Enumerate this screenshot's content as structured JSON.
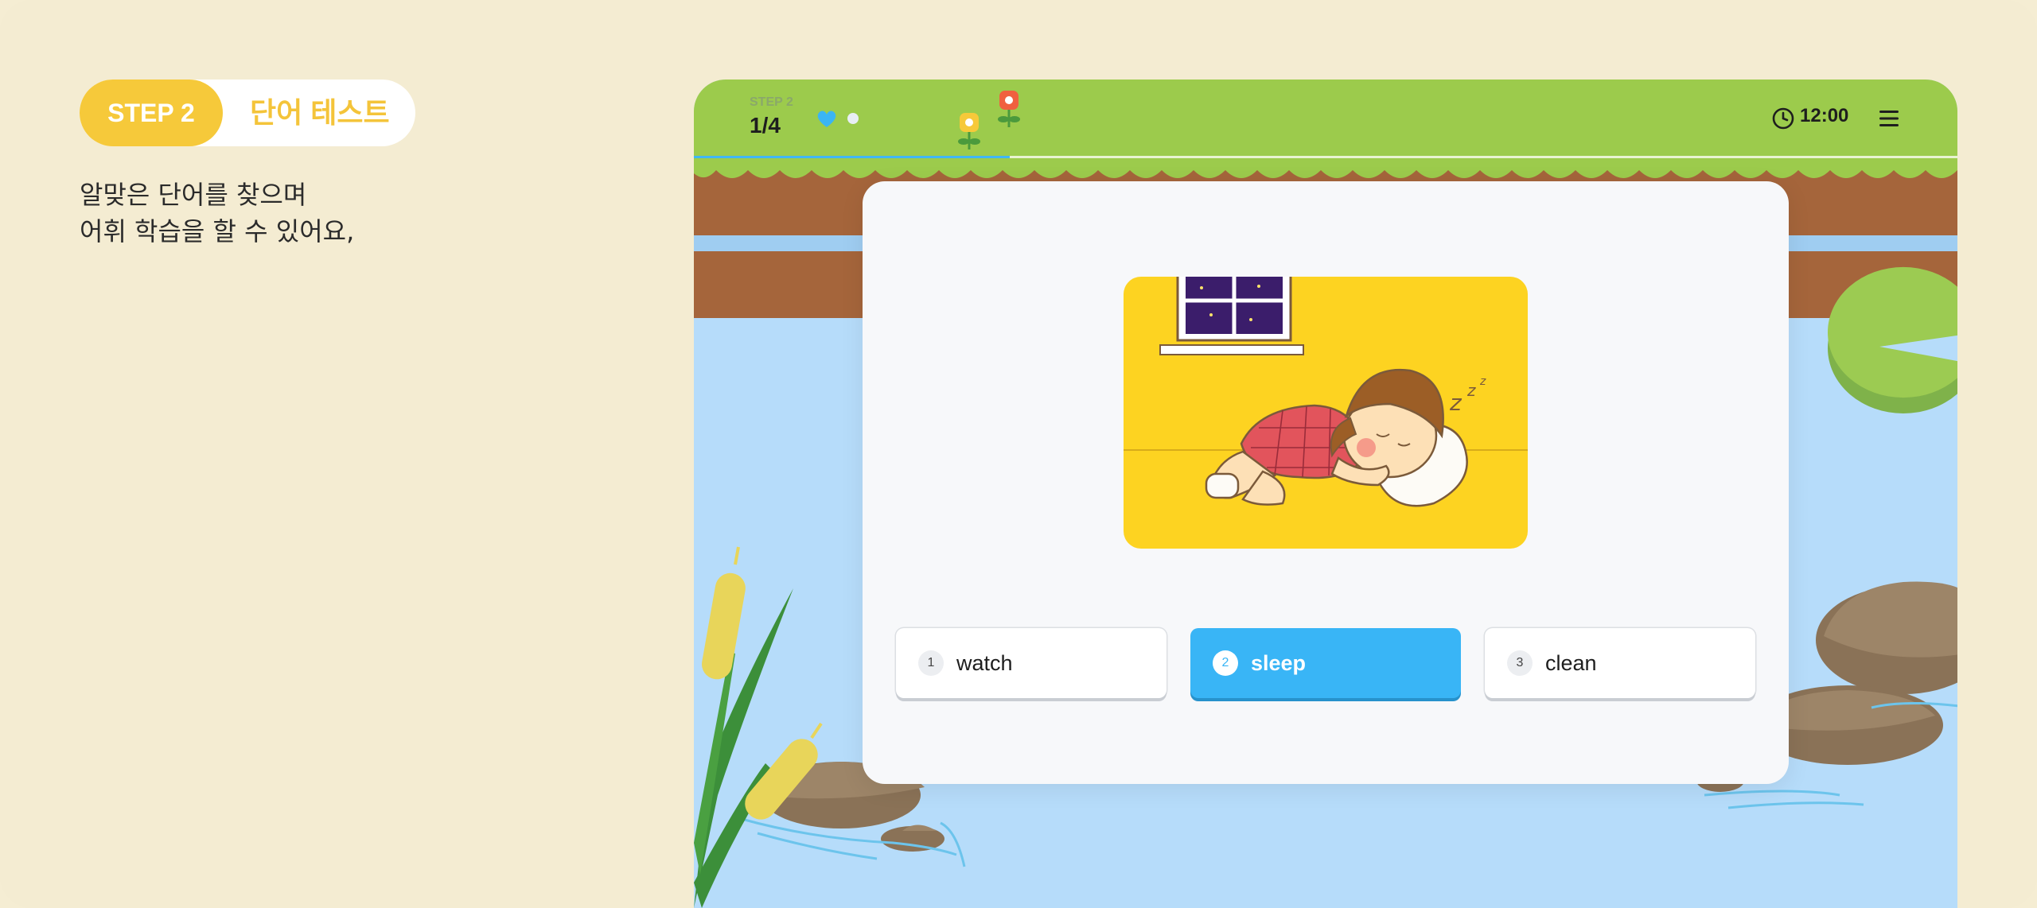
{
  "intro": {
    "step_tag": "STEP 2",
    "step_title": "단어 테스트",
    "description_lines": [
      "알맞은 단어를 찾으며",
      "어휘 학습을 할 수 있어요,"
    ]
  },
  "hud": {
    "step_label": "STEP 2",
    "question_count": "1/4",
    "progress": 0.25,
    "time": "12:00",
    "icons": [
      "heart-icon",
      "clock-icon",
      "menu-icon"
    ]
  },
  "question": {
    "image": "girl-sleeping-illustration",
    "answers": [
      {
        "num": "1",
        "label": "watch",
        "selected": false
      },
      {
        "num": "2",
        "label": "sleep",
        "selected": true
      },
      {
        "num": "3",
        "label": "clean",
        "selected": false
      }
    ]
  },
  "colors": {
    "accent_yellow": "#f6c93a",
    "selected_blue": "#39b5f6",
    "grass": "#9ccb4c",
    "water": "#b6dcfa",
    "background": "#f4ecd2"
  }
}
